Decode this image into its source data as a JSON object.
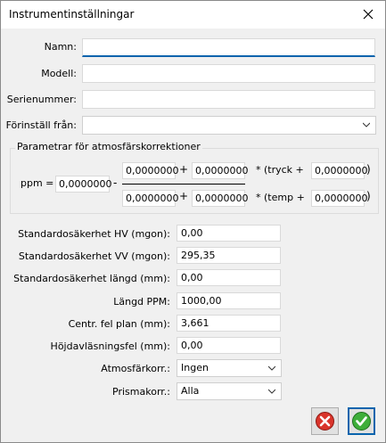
{
  "window": {
    "title": "Instrumentinställningar"
  },
  "identity": {
    "name_label": "Namn:",
    "name_value": "",
    "model_label": "Modell:",
    "model_value": "",
    "serial_label": "Serienummer:",
    "serial_value": "",
    "preset_label": "Förinställ från:",
    "preset_value": ""
  },
  "atmos": {
    "group_title": "Parametrar för atmosfärskorrektioner",
    "ppm_eq": "ppm =",
    "constant": "0,0000000",
    "minus": "-",
    "plus1": "+",
    "plus2": "+",
    "num_a": "0,0000000",
    "num_b": "0,0000000",
    "den_a": "0,0000000",
    "den_b": "0,0000000",
    "tryck_label": "* (tryck +",
    "tryck_value": "0,0000000",
    "temp_label": "* (temp +",
    "temp_value": "0,0000000",
    "close1": ")",
    "close2": ")"
  },
  "params": [
    {
      "label": "Standardosäkerhet HV (mgon):",
      "value": "0,00"
    },
    {
      "label": "Standardosäkerhet VV (mgon):",
      "value": "295,35"
    },
    {
      "label": "Standardosäkerhet längd (mm):",
      "value": "0,00"
    },
    {
      "label": "Längd PPM:",
      "value": "1000,00"
    },
    {
      "label": "Centr. fel plan (mm):",
      "value": "3,661"
    },
    {
      "label": "Höjdavläsningsfel (mm):",
      "value": "0,00"
    }
  ],
  "atmos_corr": {
    "label": "Atmosfärkorr.:",
    "value": "Ingen"
  },
  "prism_corr": {
    "label": "Prismakorr.:",
    "value": "Alla"
  },
  "icons": {
    "close": "close-icon",
    "cancel": "cancel-icon",
    "ok": "ok-icon"
  }
}
